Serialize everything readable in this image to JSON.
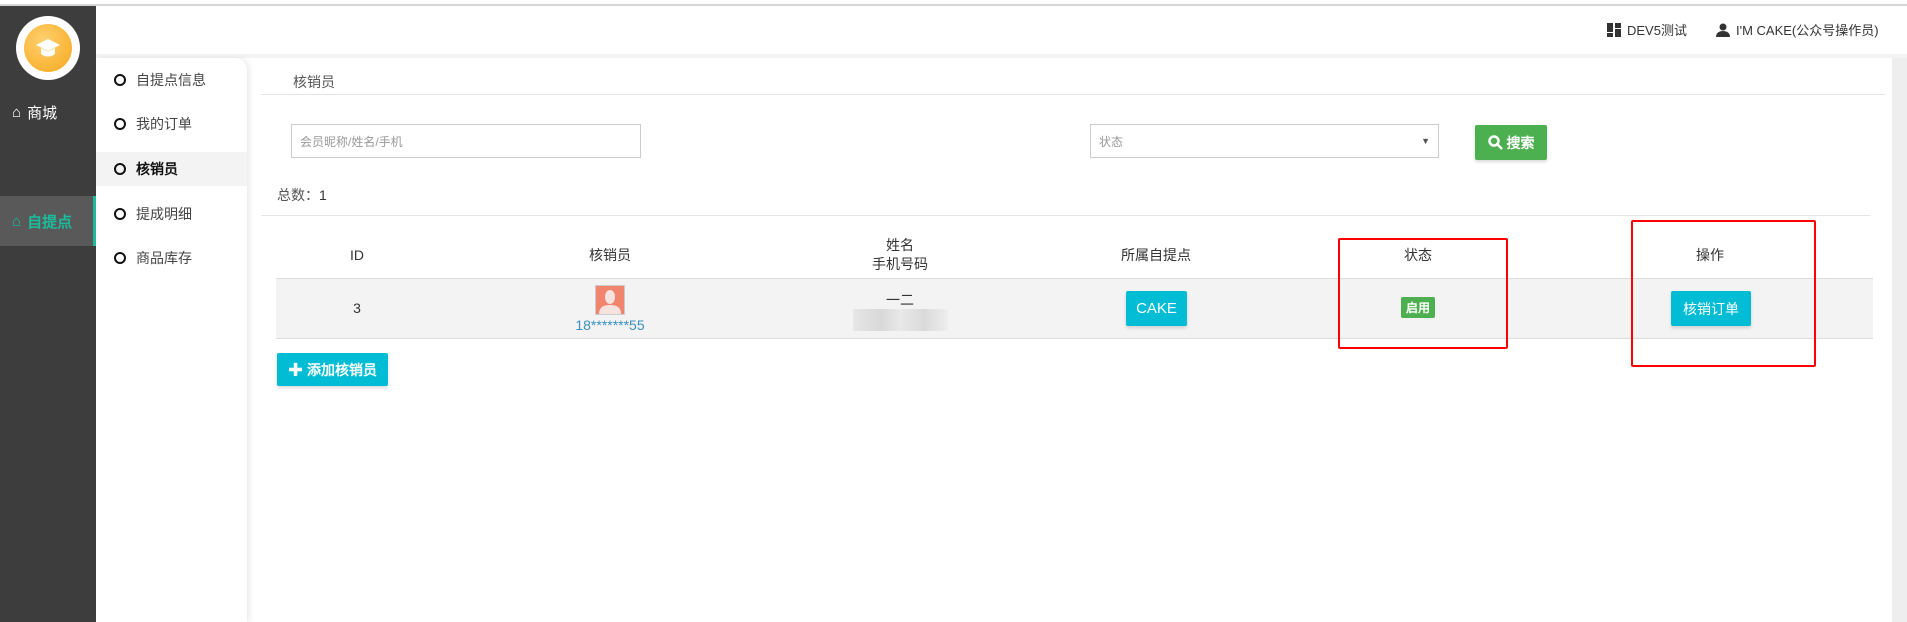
{
  "header": {
    "workspace": "DEV5测试",
    "user": "I'M CAKE(公众号操作员)"
  },
  "main_nav": [
    {
      "label": "商城",
      "icon": "home-icon"
    },
    {
      "label": "自提点",
      "icon": "home-icon",
      "active": true
    }
  ],
  "sub_nav": [
    {
      "label": "自提点信息"
    },
    {
      "label": "我的订单"
    },
    {
      "label": "核销员",
      "active": true
    },
    {
      "label": "提成明细"
    },
    {
      "label": "商品库存"
    }
  ],
  "breadcrumb": "核销员",
  "search": {
    "keyword_placeholder": "会员昵称/姓名/手机",
    "status_placeholder": "状态",
    "search_label": "搜索"
  },
  "total": {
    "label": "总数：",
    "value": "1"
  },
  "table": {
    "headers": {
      "id": "ID",
      "verifier": "核销员",
      "name": "姓名",
      "phone": "手机号码",
      "pickup_point": "所属自提点",
      "status": "状态",
      "action": "操作"
    },
    "rows": [
      {
        "id": "3",
        "phone_masked": "18*******55",
        "name": "一二",
        "pickup_point": "CAKE",
        "status": "启用",
        "action": "核销订单"
      }
    ]
  },
  "add_label": "添加核销员",
  "colors": {
    "sidebar": "#3d3d3d",
    "accent": "#1bbc9b",
    "primary": "#00bcd4",
    "success": "#4caf50",
    "highlight": "#ff0000"
  }
}
